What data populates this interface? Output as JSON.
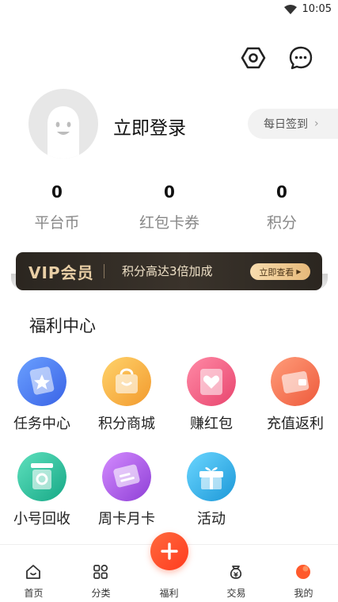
{
  "status_bar": {
    "time": "10:05"
  },
  "header": {
    "settings_icon": "hexagon-gear-icon",
    "message_icon": "chat-bubble-icon"
  },
  "profile": {
    "login_text": "立即登录",
    "checkin_label": "每日签到"
  },
  "stats": [
    {
      "value": "0",
      "label": "平台币"
    },
    {
      "value": "0",
      "label": "红包卡券"
    },
    {
      "value": "0",
      "label": "积分"
    }
  ],
  "vip": {
    "logo": "VIP会员",
    "text": "积分高达3倍加成",
    "button": "立即查看"
  },
  "welfare": {
    "title": "福利中心",
    "items": [
      {
        "label": "任务中心",
        "icon": "task-star-icon",
        "color": "#4a7cf0"
      },
      {
        "label": "积分商城",
        "icon": "shopping-bag-icon",
        "color": "#f5b244"
      },
      {
        "label": "赚红包",
        "icon": "heart-envelope-icon",
        "color": "#f26486"
      },
      {
        "label": "充值返利",
        "icon": "wallet-icon",
        "color": "#f27a5a"
      },
      {
        "label": "小号回收",
        "icon": "recycle-bin-icon",
        "color": "#2cc2a0"
      },
      {
        "label": "周卡月卡",
        "icon": "card-icon",
        "color": "#b05ae0"
      },
      {
        "label": "活动",
        "icon": "gift-box-icon",
        "color": "#35b8e8"
      }
    ]
  },
  "nav": {
    "items": [
      {
        "label": "首页",
        "icon": "home-icon"
      },
      {
        "label": "分类",
        "icon": "grid-icon"
      },
      {
        "label": "福利",
        "icon": "plus-icon"
      },
      {
        "label": "交易",
        "icon": "money-bag-icon"
      },
      {
        "label": "我的",
        "icon": "profile-dot-icon"
      }
    ],
    "accent_color": "#ff4a26"
  }
}
